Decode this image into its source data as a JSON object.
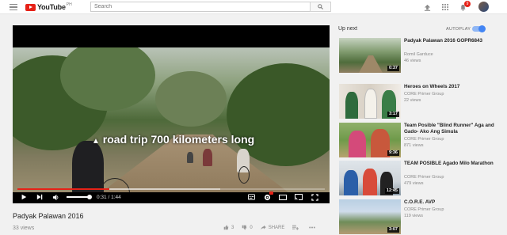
{
  "header": {
    "logo_text": "YouTube",
    "logo_sup": "PH",
    "search_placeholder": "Search",
    "notification_count": "9"
  },
  "player": {
    "caption": "road trip 700 kilometers long",
    "current_time": "0:31",
    "total_time": "1:44",
    "time_display": "0:31 / 1:44",
    "progress_fraction": 0.3,
    "loaded_fraction": 0.66,
    "volume_fraction": 1.0
  },
  "video": {
    "title": "Padyak Palawan 2016",
    "views": "33 views",
    "likes": "3",
    "dislikes": "0",
    "share_label": "SHARE"
  },
  "sidebar": {
    "up_next_label": "Up next",
    "autoplay_label": "AUTOPLAY",
    "autoplay_on": true,
    "items": [
      {
        "title": "Padyak Palawan 2016 GOPR6843",
        "channel": "Romil Garduce",
        "views": "46 views",
        "duration": "0:37"
      },
      {
        "title": "Heroes on Wheels 2017",
        "channel": "CORE Primer Group",
        "views": "22 views",
        "duration": "3:17"
      },
      {
        "title": "Team Posible \"Blind Runner\" Aga and Gado- Ako Ang Simula",
        "channel": "CORE Primer Group",
        "views": "871 views",
        "duration": "9:36"
      },
      {
        "title": "TEAM POSIBLE Agado Milo Marathon",
        "channel": "CORE Primer Group",
        "views": "479 views",
        "duration": "12:45"
      },
      {
        "title": "C.O.R.E. AVP",
        "channel": "CORE Primer Group",
        "views": "119 views",
        "duration": "3:07"
      }
    ]
  }
}
